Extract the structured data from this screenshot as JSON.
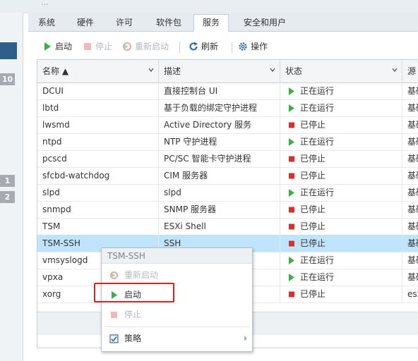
{
  "window": {
    "title_fragment": "..."
  },
  "left_badges": [
    "10",
    "1",
    "2"
  ],
  "tabs": [
    {
      "label": "系统"
    },
    {
      "label": "硬件"
    },
    {
      "label": "许可"
    },
    {
      "label": "软件包"
    },
    {
      "label": "服务"
    },
    {
      "label": "安全和用户"
    }
  ],
  "active_tab": "服务",
  "toolbar": {
    "start": "启动",
    "stop": "停止",
    "restart": "重新启动",
    "refresh": "刷新",
    "actions": "操作"
  },
  "columns": {
    "name": "名称 ▲",
    "description": "描述",
    "status": "状态",
    "source": "源"
  },
  "rows": [
    {
      "name": "DCUI",
      "description": "直接控制台 UI",
      "status": "正在运行",
      "running": true,
      "source": "基础"
    },
    {
      "name": "lbtd",
      "description": "基于负载的绑定守护进程",
      "status": "正在运行",
      "running": true,
      "source": "基础"
    },
    {
      "name": "lwsmd",
      "description": "Active Directory 服务",
      "status": "已停止",
      "running": false,
      "source": "基础"
    },
    {
      "name": "ntpd",
      "description": "NTP 守护进程",
      "status": "正在运行",
      "running": true,
      "source": "基础"
    },
    {
      "name": "pcscd",
      "description": "PC/SC 智能卡守护进程",
      "status": "已停止",
      "running": false,
      "source": "基础"
    },
    {
      "name": "sfcbd-watchdog",
      "description": "CIM 服务器",
      "status": "已停止",
      "running": false,
      "source": "基础"
    },
    {
      "name": "slpd",
      "description": "slpd",
      "status": "正在运行",
      "running": true,
      "source": "基础"
    },
    {
      "name": "snmpd",
      "description": "SNMP 服务器",
      "status": "已停止",
      "running": false,
      "source": "基础"
    },
    {
      "name": "TSM",
      "description": "ESXi Shell",
      "status": "已停止",
      "running": false,
      "source": "基础"
    },
    {
      "name": "TSM-SSH",
      "description": "SSH",
      "status": "已停止",
      "running": false,
      "source": "基础",
      "selected": true
    },
    {
      "name": "vmsyslogd",
      "description": "",
      "status": "正在运行",
      "running": true,
      "source": "基础"
    },
    {
      "name": "vpxa",
      "description": "",
      "status": "正在运行",
      "running": true,
      "source": "基础"
    },
    {
      "name": "xorg",
      "description": "",
      "status": "已停止",
      "running": false,
      "source": "esx"
    }
  ],
  "context_menu": {
    "header": "TSM-SSH",
    "restart": "重新启动",
    "start": "启动",
    "stop": "停止",
    "policy": "策略"
  },
  "colors": {
    "running_green": "#3cb043",
    "stopped_red": "#d9302c",
    "selection_blue": "#bfe4fb",
    "highlight_red": "#e02020"
  }
}
